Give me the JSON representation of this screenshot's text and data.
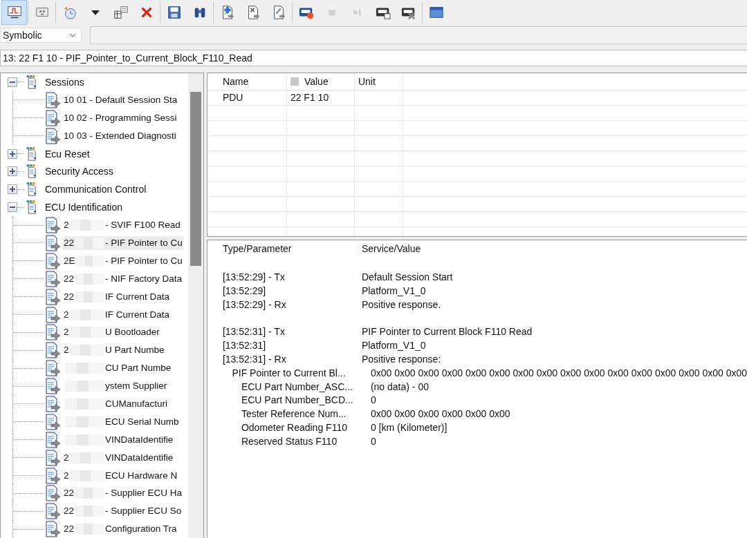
{
  "toolbar": {
    "groups": [
      [
        {
          "selected": true,
          "disabled": false
        }
      ],
      [
        {
          "selected": false,
          "disabled": false
        }
      ],
      [
        {
          "selected": false,
          "disabled": false
        },
        {
          "selected": false,
          "disabled": false
        },
        {
          "selected": false,
          "disabled": false
        },
        {
          "selected": false,
          "disabled": false
        }
      ],
      [
        {
          "selected": false,
          "disabled": false
        },
        {
          "selected": false,
          "disabled": false
        }
      ],
      [
        {
          "selected": false,
          "disabled": false
        },
        {
          "selected": false,
          "disabled": false
        },
        {
          "selected": false,
          "disabled": false
        }
      ],
      [
        {
          "selected": false,
          "disabled": false
        },
        {
          "selected": false,
          "disabled": true
        },
        {
          "selected": false,
          "disabled": true
        },
        {
          "selected": false,
          "disabled": false
        },
        {
          "selected": false,
          "disabled": false
        }
      ],
      [
        {
          "selected": false,
          "disabled": false
        }
      ]
    ]
  },
  "mode_select": {
    "value": "Symbolic"
  },
  "request_path": {
    "value": "13: 22 F1 10 - PIF_Pointer_to_Current_Block_F110_Read"
  },
  "service_tree": [
    {
      "label": "Sessions",
      "expanded": true,
      "children": [
        {
          "start": "10 01 - Default Session Sta",
          "selected": false
        },
        {
          "start": "10 02 - Programming Sessi",
          "selected": false
        },
        {
          "start": "10 03 - Extended Diagnosti",
          "selected": false
        }
      ]
    },
    {
      "label": "Ecu Reset",
      "expanded": false
    },
    {
      "label": "Security Access",
      "expanded": false
    },
    {
      "label": "Communication Control",
      "expanded": false
    },
    {
      "label": "ECU Identification",
      "expanded": true,
      "children": [
        {
          "start": "2",
          "end": "- SVIF F100 Read",
          "selected": false
        },
        {
          "start": "22",
          "end": "- PIF Pointer to Cu",
          "selected": true
        },
        {
          "start": "2E",
          "end": "- PIF Pointer to Cu",
          "selected": false
        },
        {
          "start": "22",
          "end": "- NIF Factory Data",
          "selected": false
        },
        {
          "start": "22",
          "end": "IF Current Data",
          "selected": false
        },
        {
          "start": "2",
          "end": "IF Current Data",
          "selected": false
        },
        {
          "start": "2",
          "end": "U Bootloader",
          "selected": false
        },
        {
          "start": "2",
          "end": "U Part Numbe",
          "selected": false
        },
        {
          "end": "CU Part Numbe",
          "selected": false
        },
        {
          "end": "ystem Supplier",
          "selected": false
        },
        {
          "end": "CUManufacturi",
          "selected": false
        },
        {
          "end": "ECU Serial Numb",
          "selected": false
        },
        {
          "end": "VINDataIdentifie",
          "selected": false
        },
        {
          "start": "2",
          "end": "VINDataIdentifie",
          "selected": false
        },
        {
          "start": "2",
          "end": "ECU Hardware N",
          "selected": false
        },
        {
          "start": "22",
          "end": "- Supplier ECU Ha",
          "selected": false
        },
        {
          "start": "22",
          "end": "- Supplier ECU So",
          "selected": false
        },
        {
          "start": "22",
          "end": "Configuration Tra",
          "selected": false
        }
      ]
    }
  ],
  "parameter_table": {
    "columns": [
      "Name",
      "Value",
      "Unit"
    ],
    "rows": [
      {
        "name": "PDU",
        "value": "22 F1 10"
      }
    ]
  },
  "trace": {
    "columns": [
      "Type/Parameter",
      "Service/Value"
    ],
    "groups": [
      [
        {
          "type": "[13:52:29] - Tx",
          "value": "Default Session Start"
        },
        {
          "type": "[13:52:29]",
          "value": "Platform_V1_0"
        },
        {
          "type": "[13:52:29] - Rx",
          "value": "Positive response."
        }
      ],
      [
        {
          "type": "[13:52:31] - Tx",
          "value": "PIF Pointer to Current Block F110 Read"
        },
        {
          "type": "[13:52:31]",
          "value": "Platform_V1_0"
        },
        {
          "type": "[13:52:31] - Rx",
          "value": "Positive response:",
          "children": [
            {
              "type": "PIF Pointer to Current Bl...",
              "value": "0x00 0x00 0x00 0x00 0x00 0x00 0x00 0x00 0x00 0x00 0x00 0x00 0x00 0x00 0x00 0x00",
              "children": [
                {
                  "type": "ECU Part Number_ASC...",
                  "value": "(no data) - 00"
                },
                {
                  "type": "ECU Part Number_BCD...",
                  "value": "0"
                },
                {
                  "type": "Tester Reference Num...",
                  "value": "0x00 0x00 0x00 0x00 0x00 0x00"
                },
                {
                  "type": "Odometer Reading F110",
                  "value": "0 [km (Kilometer)]"
                },
                {
                  "type": "Reserved Status F110",
                  "value": "0"
                }
              ]
            }
          ]
        }
      ]
    ]
  }
}
